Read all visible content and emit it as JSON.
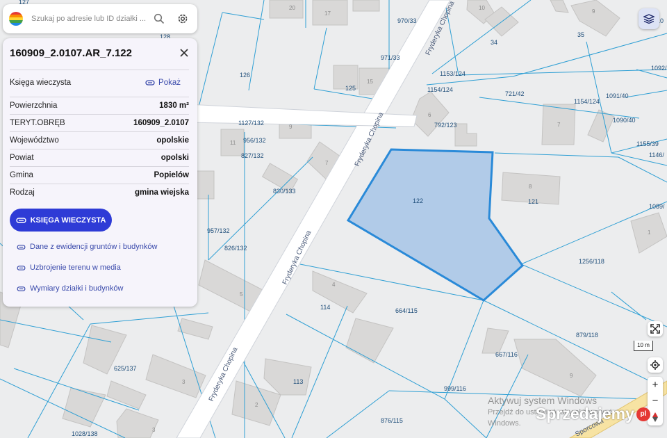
{
  "search": {
    "placeholder": "Szukaj po adresie lub ID działki ..."
  },
  "panel": {
    "title": "160909_2.0107.AR_7.122",
    "land_register_label": "Księga wieczysta",
    "show_label": "Pokaż",
    "rows": [
      {
        "label": "Powierzchnia",
        "value": "1830 m²"
      },
      {
        "label": "TERYT.OBRĘB",
        "value": "160909_2.0107"
      },
      {
        "label": "Województwo",
        "value": "opolskie"
      },
      {
        "label": "Powiat",
        "value": "opolski"
      },
      {
        "label": "Gmina",
        "value": "Popielów"
      },
      {
        "label": "Rodzaj",
        "value": "gmina wiejska"
      }
    ],
    "button_label": "KSIĘGA WIECZYSTA",
    "links": [
      "Dane z ewidencji gruntów i budynków",
      "Uzbrojenie terenu w media",
      "Wymiary działki i budynków"
    ]
  },
  "map": {
    "selected_parcel": "122",
    "street_name": "Fryderyka Chopina",
    "street_partial": "Sporcowa",
    "parcels": [
      "127",
      "128",
      "970/33",
      "971/33",
      "34",
      "35",
      "1153/124",
      "1154/124",
      "721/42",
      "1091/40",
      "1092/",
      "1154/124",
      "126",
      "125",
      "1127/132",
      "956/132",
      "827/132",
      "792/123",
      "7",
      "1090/40",
      "1155/39",
      "1146/",
      "121",
      "1089/",
      "830/133",
      "957/132",
      "826/132",
      "1256/118",
      "114",
      "664/115",
      "879/118",
      "667/116",
      "625/137",
      "113",
      "999/116",
      "876/115",
      "1028/138"
    ],
    "buildings": [
      "20",
      "17",
      "10",
      "9",
      "15",
      "6",
      "11",
      "9",
      "7",
      "7",
      "8",
      "1",
      "4",
      "5",
      "3",
      "2",
      "3",
      "9",
      "10",
      "1"
    ],
    "scale_label": "10 m"
  },
  "watermark": {
    "line1": "Aktywuj system Windows",
    "line2": "Przejdź do ustawień, aby aktywować",
    "line3": "Windows.",
    "brand": "Sprzedajemy",
    "brand_badge": "pl"
  },
  "colors": {
    "accent": "#2e3bd6",
    "parcel_fill": "#a7c4e6",
    "parcel_stroke": "#2a8ad8",
    "parcel_lines": "#2e9fd4"
  }
}
